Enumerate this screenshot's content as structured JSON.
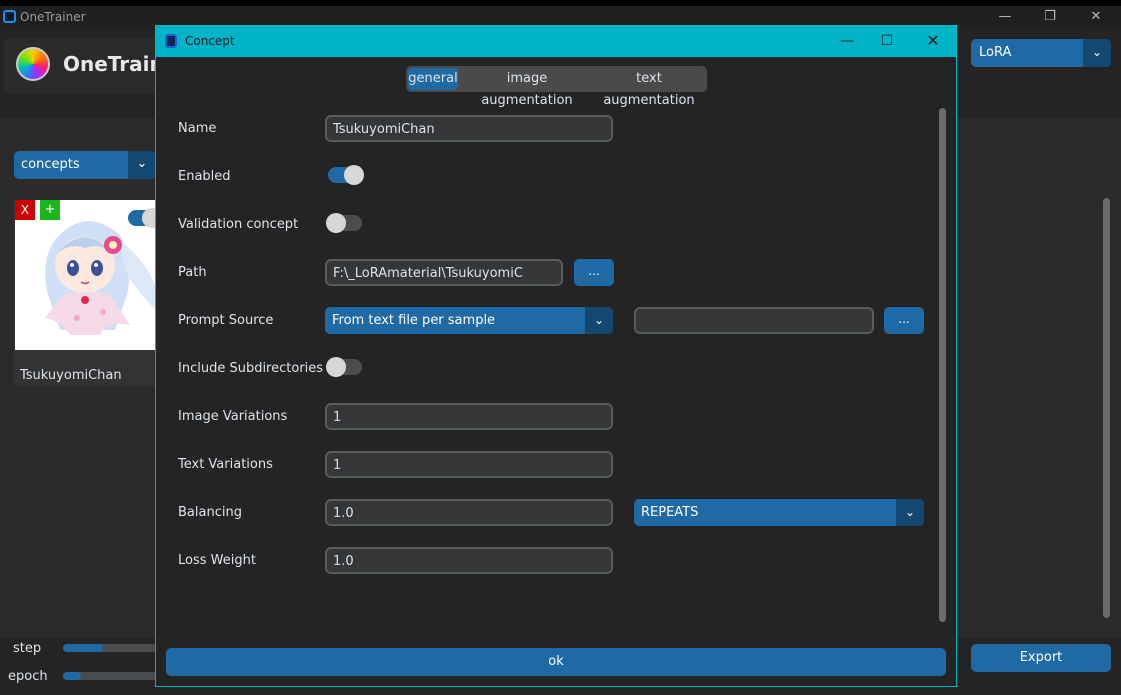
{
  "window": {
    "title": "OneTrainer"
  },
  "header": {
    "app_name": "OneTrainer"
  },
  "model_type": {
    "selected": "LoRA"
  },
  "concepts_selector": {
    "selected": "concepts"
  },
  "concept_card": {
    "name": "TsukuyomiChan",
    "remove_label": "X",
    "add_label": "+"
  },
  "progress": {
    "step_label": "step",
    "epoch_label": "epoch",
    "step_fraction": 0.4,
    "epoch_fraction": 0.18
  },
  "export_label": "Export",
  "dialog": {
    "title": "Concept",
    "tabs": [
      {
        "label": "general"
      },
      {
        "label": "image augmentation"
      },
      {
        "label": "text augmentation"
      }
    ],
    "fields": {
      "name": {
        "label": "Name",
        "value": "TsukuyomiChan"
      },
      "enabled": {
        "label": "Enabled",
        "on": true
      },
      "validation": {
        "label": "Validation concept",
        "on": false
      },
      "path": {
        "label": "Path",
        "value": "F:\\_LoRAmaterial\\TsukuyomiC",
        "browse": "..."
      },
      "prompt_source": {
        "label": "Prompt Source",
        "selected": "From text file per sample",
        "extra_value": "",
        "browse": "..."
      },
      "include_subdirs": {
        "label": "Include Subdirectories",
        "on": false
      },
      "image_variations": {
        "label": "Image Variations",
        "value": "1"
      },
      "text_variations": {
        "label": "Text Variations",
        "value": "1"
      },
      "balancing": {
        "label": "Balancing",
        "value": "1.0",
        "strategy": "REPEATS"
      },
      "loss_weight": {
        "label": "Loss Weight",
        "value": "1.0"
      }
    },
    "ok_label": "ok"
  },
  "colors": {
    "accent": "#1f6aa5",
    "dialog_titlebar": "#00b4c8"
  }
}
